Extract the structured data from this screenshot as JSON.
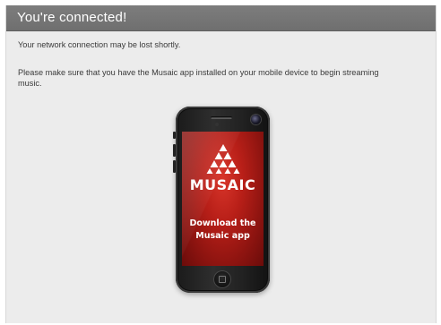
{
  "header": {
    "title": "You're connected!",
    "bg_color": "#777777"
  },
  "messages": {
    "warning": "Your network connection may be lost shortly.",
    "instruction": "Please make sure that you have the Musaic app installed on your mobile device to begin streaming music."
  },
  "phone": {
    "brand": "MUSAIC",
    "cta_line1": "Download the",
    "cta_line2": "Musaic app",
    "screen_color": "#b81f18"
  }
}
